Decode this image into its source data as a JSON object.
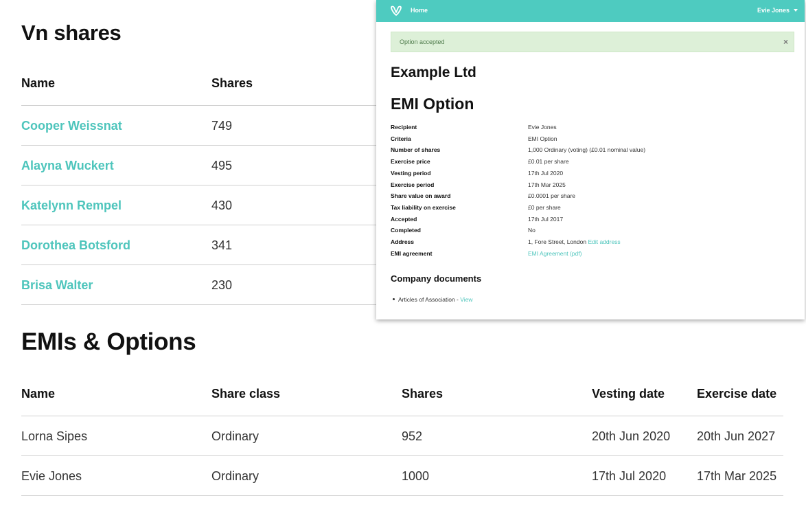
{
  "shares_section": {
    "title": "Vn shares",
    "headers": {
      "name": "Name",
      "shares": "Shares"
    },
    "rows": [
      {
        "name": "Cooper Weissnat",
        "shares": "749"
      },
      {
        "name": "Alayna Wuckert",
        "shares": "495"
      },
      {
        "name": "Katelynn Rempel",
        "shares": "430"
      },
      {
        "name": "Dorothea Botsford",
        "shares": "341"
      },
      {
        "name": "Brisa Walter",
        "shares": "230"
      }
    ]
  },
  "emi_section": {
    "title": "EMIs & Options",
    "headers": {
      "name": "Name",
      "share_class": "Share class",
      "shares": "Shares",
      "vesting_date": "Vesting date",
      "exercise_date": "Exercise date"
    },
    "rows": [
      {
        "name": "Lorna Sipes",
        "share_class": "Ordinary",
        "shares": "952",
        "vesting_date": "20th Jun 2020",
        "exercise_date": "20th Jun 2027"
      },
      {
        "name": "Evie Jones",
        "share_class": "Ordinary",
        "shares": "1000",
        "vesting_date": "17th Jul 2020",
        "exercise_date": "17th Mar 2025"
      }
    ]
  },
  "overlay": {
    "navbar": {
      "home_label": "Home",
      "user_label": "Evie Jones",
      "logo_icon": "v-logo-icon",
      "caret_icon": "caret-down-icon",
      "color": "#4ecbc0"
    },
    "alert": {
      "text": "Option accepted",
      "close": "×"
    },
    "company_title": "Example Ltd",
    "option_title": "EMI Option",
    "details": {
      "recipient": {
        "label": "Recipient",
        "value": "Evie Jones"
      },
      "criteria": {
        "label": "Criteria",
        "value": "EMI Option"
      },
      "number_of_shares": {
        "label": "Number of shares",
        "value": "1,000 Ordinary (voting) (£0.01 nominal value)"
      },
      "exercise_price": {
        "label": "Exercise price",
        "value": "£0.01 per share"
      },
      "vesting_period": {
        "label": "Vesting period",
        "value": "17th Jul 2020"
      },
      "exercise_period": {
        "label": "Exercise period",
        "value": "17th Mar 2025"
      },
      "share_value": {
        "label": "Share value on award",
        "value": "£0.0001 per share"
      },
      "tax_liability": {
        "label": "Tax liability on exercise",
        "value": "£0 per share"
      },
      "accepted": {
        "label": "Accepted",
        "value": "17th Jul 2017"
      },
      "completed": {
        "label": "Completed",
        "value": "No"
      },
      "address": {
        "label": "Address",
        "value": "1, Fore Street, London",
        "link": "Edit address"
      },
      "emi_agreement": {
        "label": "EMI agreement",
        "link": "EMI Agreement (pdf)"
      }
    },
    "documents": {
      "title": "Company documents",
      "items": [
        {
          "label": "Articles of Association - ",
          "link": "View"
        }
      ]
    }
  },
  "colors": {
    "accent": "#4ec5bc",
    "alert_bg": "#ddf0d8"
  }
}
